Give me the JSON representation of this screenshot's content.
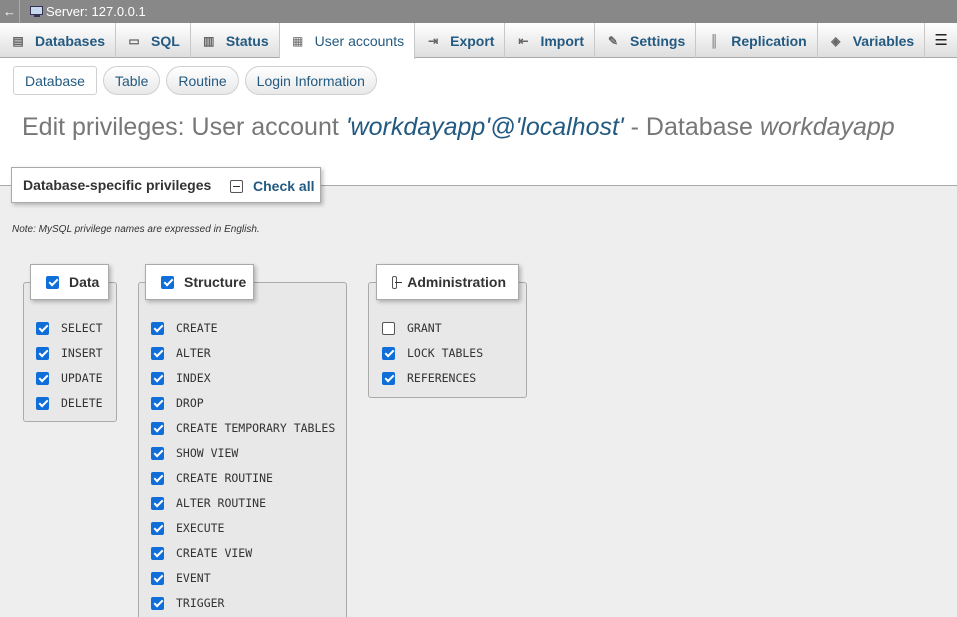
{
  "serverbar": {
    "back": "←",
    "title": "Server: 127.0.0.1"
  },
  "tabs": [
    {
      "label": "Databases",
      "icon": "database-icon",
      "glyph": "▤"
    },
    {
      "label": "SQL",
      "icon": "sql-icon",
      "glyph": "▭"
    },
    {
      "label": "Status",
      "icon": "status-icon",
      "glyph": "▥"
    },
    {
      "label": "User accounts",
      "icon": "user-accounts-icon",
      "glyph": "▦"
    },
    {
      "label": "Export",
      "icon": "export-icon",
      "glyph": "⇥"
    },
    {
      "label": "Import",
      "icon": "import-icon",
      "glyph": "⇤"
    },
    {
      "label": "Settings",
      "icon": "wrench-icon",
      "glyph": "✎"
    },
    {
      "label": "Replication",
      "icon": "replication-icon",
      "glyph": "║"
    },
    {
      "label": "Variables",
      "icon": "variables-icon",
      "glyph": "◈"
    }
  ],
  "menu_glyph": "☰",
  "subtabs": [
    "Database",
    "Table",
    "Routine",
    "Login Information"
  ],
  "heading": {
    "prefix": "Edit privileges: User account ",
    "account": "'workdayapp'@'localhost'",
    "middle": " - Database ",
    "database": "workdayapp"
  },
  "privileges": {
    "legend": "Database-specific privileges",
    "check_all": "Check all",
    "note": "Note: MySQL privilege names are expressed in English."
  },
  "groups": {
    "data": {
      "label": "Data",
      "items": [
        "SELECT",
        "INSERT",
        "UPDATE",
        "DELETE"
      ]
    },
    "structure": {
      "label": "Structure",
      "items": [
        "CREATE",
        "ALTER",
        "INDEX",
        "DROP",
        "CREATE TEMPORARY TABLES",
        "SHOW VIEW",
        "CREATE ROUTINE",
        "ALTER ROUTINE",
        "EXECUTE",
        "CREATE VIEW",
        "EVENT",
        "TRIGGER"
      ]
    },
    "administration": {
      "label": "Administration",
      "items": [
        "GRANT",
        "LOCK TABLES",
        "REFERENCES"
      ],
      "checked": [
        false,
        true,
        true
      ]
    }
  },
  "colors": {
    "accent": "#235a81",
    "checkbox": "#0f6ed8"
  }
}
